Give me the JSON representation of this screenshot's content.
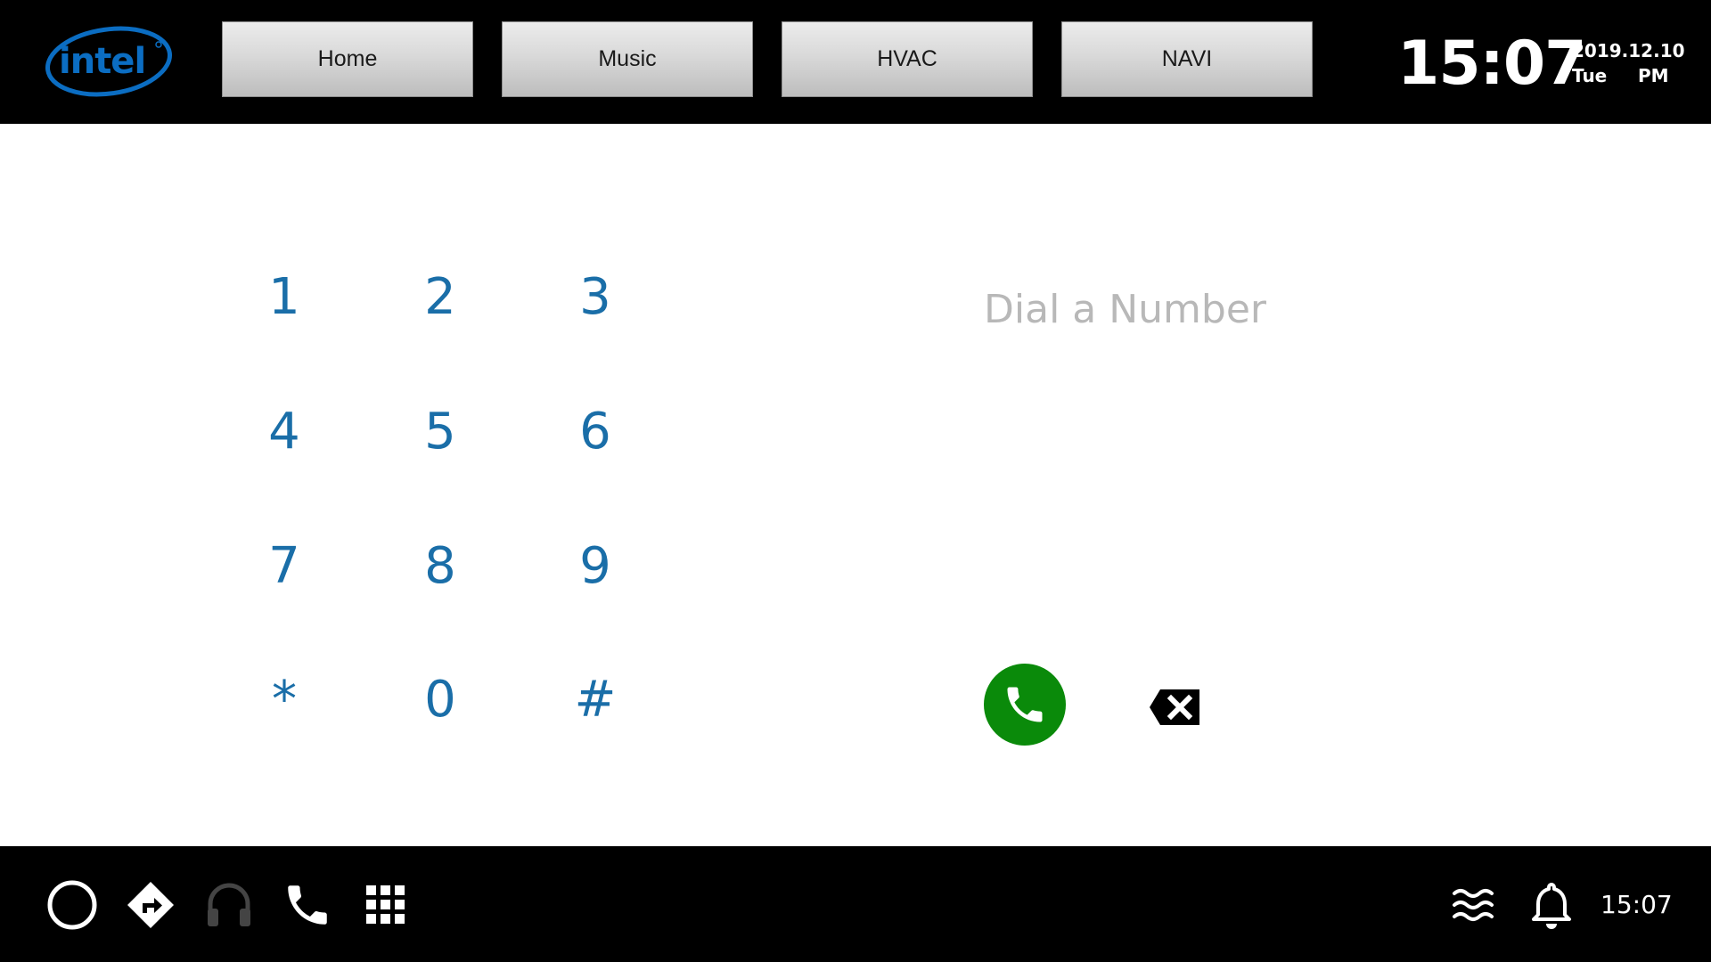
{
  "header": {
    "logo_text": "intel",
    "nav_buttons": [
      "Home",
      "Music",
      "HVAC",
      "NAVI"
    ],
    "time": "15:07",
    "date": "2019.12.10",
    "weekday": "Tue",
    "ampm": "PM"
  },
  "dialer": {
    "keys": [
      "1",
      "2",
      "3",
      "4",
      "5",
      "6",
      "7",
      "8",
      "9",
      "*",
      "0",
      "#"
    ],
    "placeholder": "Dial a Number",
    "key_color": "#1a6ea8",
    "call_button_color": "#0a8a0a"
  },
  "bottom_bar": {
    "icons": [
      "home-circle-icon",
      "directions-icon",
      "headphones-icon",
      "phone-icon",
      "apps-grid-icon",
      "hvac-waves-icon",
      "notification-bell-icon"
    ],
    "time": "15:07"
  }
}
